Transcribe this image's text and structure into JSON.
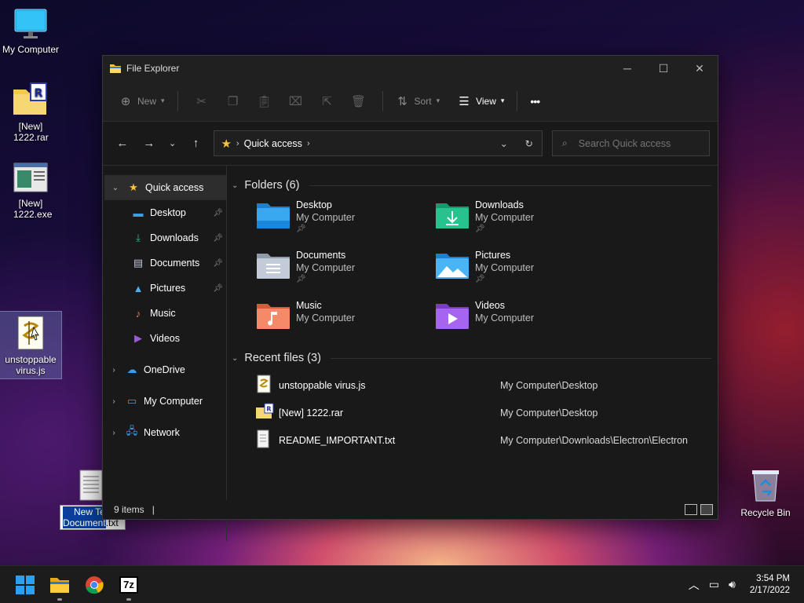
{
  "desktop": {
    "icons": [
      {
        "label": "My Computer"
      },
      {
        "label": "[New] 1222.rar"
      },
      {
        "label": "[New] 1222.exe"
      },
      {
        "label": "unstoppable virus.js"
      },
      {
        "label_line1": "New Te",
        "label_line2_sel": "Document",
        "label_line2_ext": ".txt"
      },
      {
        "label": "Recycle Bin"
      }
    ]
  },
  "window": {
    "title": "File Explorer",
    "controls": {
      "minimize": "─",
      "maximize": "☐",
      "close": "✕"
    },
    "commandbar": {
      "new_label": "New",
      "sort_label": "Sort",
      "view_label": "View",
      "more_label": "•••"
    },
    "address": {
      "crumb": "Quick access",
      "search_placeholder": "Search Quick access"
    },
    "nav": {
      "quick_access": "Quick access",
      "pinned": [
        {
          "label": "Desktop"
        },
        {
          "label": "Downloads"
        },
        {
          "label": "Documents"
        },
        {
          "label": "Pictures"
        },
        {
          "label": "Music"
        },
        {
          "label": "Videos"
        }
      ],
      "onedrive": "OneDrive",
      "my_computer": "My Computer",
      "network": "Network"
    },
    "folders_header": "Folders (6)",
    "folders": [
      {
        "name": "Desktop",
        "location": "My Computer",
        "pinned": true
      },
      {
        "name": "Downloads",
        "location": "My Computer",
        "pinned": true
      },
      {
        "name": "Documents",
        "location": "My Computer",
        "pinned": true
      },
      {
        "name": "Pictures",
        "location": "My Computer",
        "pinned": true
      },
      {
        "name": "Music",
        "location": "My Computer",
        "pinned": false
      },
      {
        "name": "Videos",
        "location": "My Computer",
        "pinned": false
      }
    ],
    "recent_header": "Recent files (3)",
    "recent": [
      {
        "name": "unstoppable virus.js",
        "path": "My Computer\\Desktop"
      },
      {
        "name": "[New] 1222.rar",
        "path": "My Computer\\Desktop"
      },
      {
        "name": "README_IMPORTANT.txt",
        "path": "My Computer\\Downloads\\Electron\\Electron"
      }
    ],
    "status": {
      "items": "9 items"
    }
  },
  "taskbar": {
    "time": "3:54 PM",
    "date": "2/17/2022",
    "sevenzip_label": "7z"
  },
  "colors": {
    "accent": "#0078d4",
    "folder_yellow": "#f5c542",
    "window_bg": "#191919"
  }
}
